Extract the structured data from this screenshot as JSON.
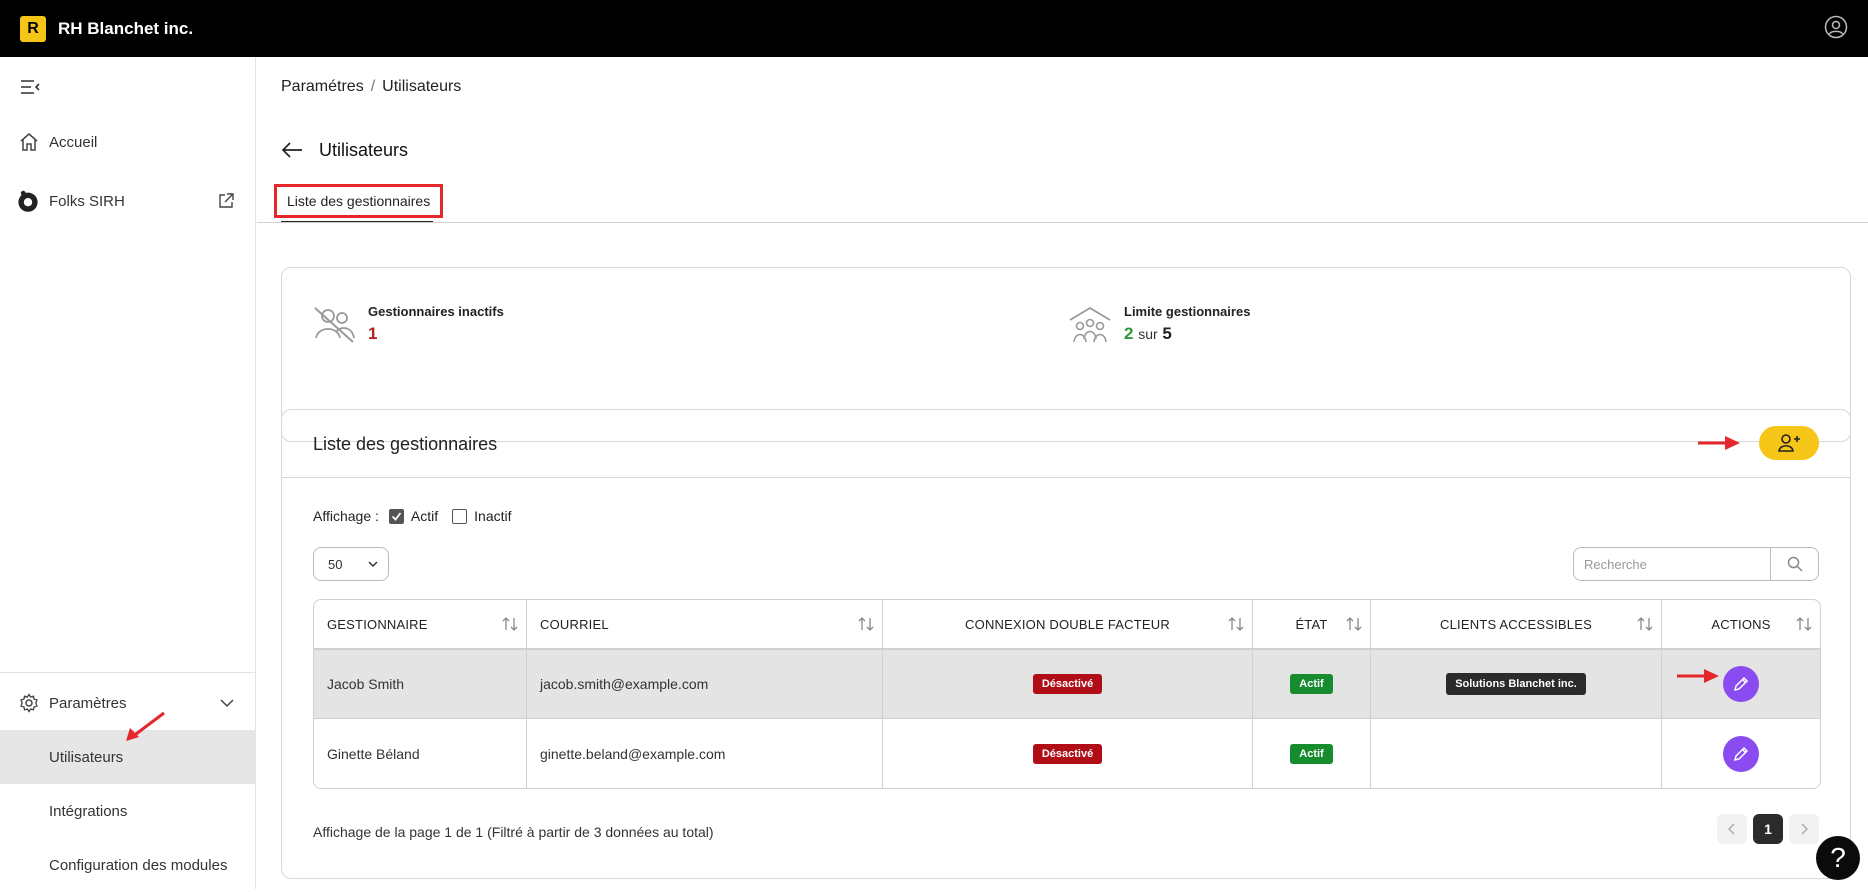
{
  "app": {
    "logo_letter": "R",
    "name": "RH Blanchet inc."
  },
  "sidebar": {
    "items": [
      {
        "label": "Accueil",
        "icon": "home-icon"
      },
      {
        "label": "Folks SIRH",
        "icon": "folks-logo-icon"
      }
    ],
    "settings": {
      "label": "Paramètres",
      "children": [
        {
          "label": "Utilisateurs",
          "active": true
        },
        {
          "label": "Intégrations"
        },
        {
          "label": "Configuration des modules"
        }
      ]
    }
  },
  "breadcrumb": {
    "parent": "Paramétres",
    "separator": "/",
    "current": "Utilisateurs"
  },
  "page": {
    "title": "Utilisateurs"
  },
  "tabs": [
    {
      "label": "Liste des gestionnaires",
      "active": true
    }
  ],
  "stats": {
    "inactive": {
      "label": "Gestionnaires inactifs",
      "value": "1"
    },
    "limit": {
      "label": "Limite gestionnaires",
      "used": "2",
      "sep": "sur",
      "max": "5"
    }
  },
  "list": {
    "title": "Liste des gestionnaires",
    "filter": {
      "label": "Affichage :",
      "active": {
        "label": "Actif",
        "checked": true
      },
      "inactive": {
        "label": "Inactif",
        "checked": false
      }
    },
    "page_size": "50",
    "search_placeholder": "Recherche",
    "columns": [
      "GESTIONNAIRE",
      "COURRIEL",
      "CONNEXION DOUBLE FACTEUR",
      "ÉTAT",
      "CLIENTS ACCESSIBLES",
      "ACTIONS"
    ],
    "rows": [
      {
        "name": "Jacob Smith",
        "email": "jacob.smith@example.com",
        "two_factor": "Désactivé",
        "state": "Actif",
        "clients": "Solutions Blanchet inc."
      },
      {
        "name": "Ginette Béland",
        "email": "ginette.beland@example.com",
        "two_factor": "Désactivé",
        "state": "Actif",
        "clients": ""
      }
    ],
    "footer": "Affichage de la page 1 de 1 (Filtré à partir de 3 données au total)",
    "current_page": "1"
  },
  "help_label": "?",
  "colors": {
    "accent": "#f5c518",
    "danger": "#b10d17",
    "success": "#168c2f",
    "action": "#8a4cf0",
    "annotation": "#e3272b"
  }
}
